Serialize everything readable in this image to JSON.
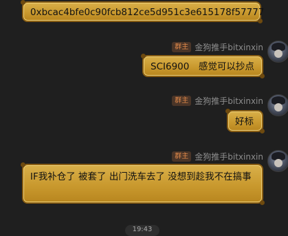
{
  "messages": [
    {
      "text": "0xbcac4bfe0c90fcb812ce5d951c3e615178f57777"
    },
    {
      "badge": "群主",
      "sender": "金狗推手bitxinxin",
      "text": "SCI6900　感觉可以抄点"
    },
    {
      "badge": "群主",
      "sender": "金狗推手bitxinxin",
      "text": "好标"
    },
    {
      "badge": "群主",
      "sender": "金狗推手bitxinxin",
      "text": "IF我补仓了 被套了 出门洗车去了 没想到趁我不在搞事"
    }
  ],
  "timestamp": "19:43",
  "colors": {
    "bubble": "#d0a23b",
    "bubble_border": "#8a5f14",
    "badge_bg": "#4a3528",
    "badge_text": "#e0894a",
    "background": "#1f1f1f"
  }
}
